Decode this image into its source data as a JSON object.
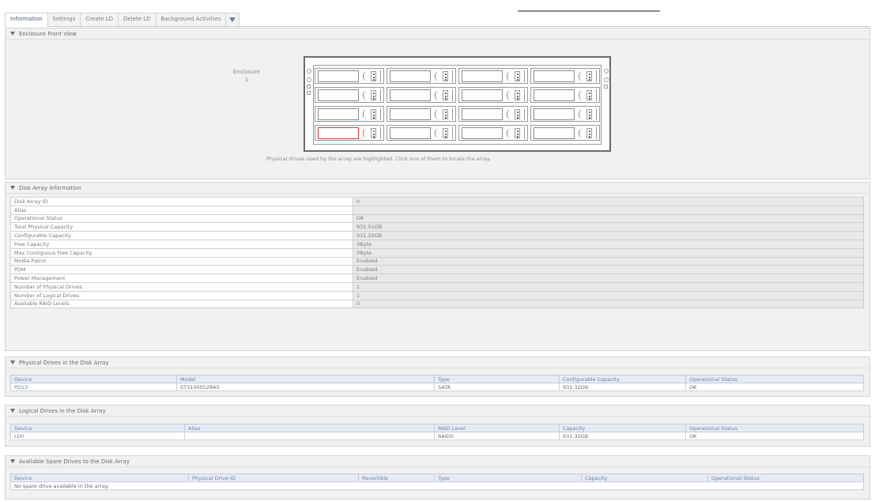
{
  "tabs": [
    {
      "label": "Information",
      "active": true
    },
    {
      "label": "Settings"
    },
    {
      "label": "Create LD"
    },
    {
      "label": "Delete LD"
    },
    {
      "label": "Background Activities"
    }
  ],
  "enclosure_section": {
    "title": "Enclosure Front View",
    "enclosure_label": "Enclosure",
    "enclosure_number": "1",
    "note": "Physical drives used by the array are highlighted. Click one of them to locate the array.",
    "rows": 4,
    "columns": 4,
    "highlighted_bay": {
      "row": 4,
      "column": 1
    }
  },
  "disk_array_info": {
    "title": "Disk Array Information",
    "rows": [
      {
        "key": "Disk Array ID",
        "value": "0"
      },
      {
        "key": "Alias",
        "value": ""
      },
      {
        "key": "Operational Status",
        "value": "OK"
      },
      {
        "key": "Total Physical Capacity",
        "value": "931.51GB"
      },
      {
        "key": "Configurable Capacity",
        "value": "931.32GB"
      },
      {
        "key": "Free Capacity",
        "value": "0Byte"
      },
      {
        "key": "Max Contiguous Free Capacity",
        "value": "0Byte"
      },
      {
        "key": "Media Patrol",
        "value": "Enabled"
      },
      {
        "key": "PDM",
        "value": "Enabled"
      },
      {
        "key": "Power Management",
        "value": "Enabled"
      },
      {
        "key": "Number of Physical Drives",
        "value": "1"
      },
      {
        "key": "Number of Logical Drives",
        "value": "1"
      },
      {
        "key": "Available RAID Levels",
        "value": "0"
      }
    ]
  },
  "physical_drives": {
    "title": "Physical Drives in the Disk Array",
    "headers": [
      "Device",
      "Model",
      "Type",
      "Configurable Capacity",
      "Operational Status"
    ],
    "rows": [
      [
        "PD13",
        "ST31000528AS",
        "SATA",
        "931.32GB",
        "OK"
      ]
    ]
  },
  "logical_drives": {
    "title": "Logical Drives in the Disk Array",
    "headers": [
      "Device",
      "Alias",
      "RAID Level",
      "Capacity",
      "Operational Status"
    ],
    "rows": [
      [
        "LD0",
        "",
        "RAID0",
        "931.32GB",
        "OK"
      ]
    ]
  },
  "spare_drives": {
    "title": "Available Spare Drives to the Disk Array",
    "headers": [
      "Device",
      "Physical Drive ID",
      "Revertible",
      "Type",
      "Capacity",
      "Operational Status"
    ],
    "empty_message": "No spare drive available in the array."
  },
  "colors": {
    "highlight": "#d23b3b",
    "header_link": "#6b7fa8",
    "led_active": "#5aa84a"
  }
}
